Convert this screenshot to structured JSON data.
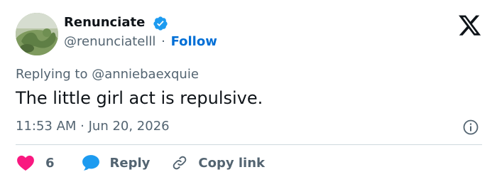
{
  "author": {
    "display_name": "Renunciate",
    "handle": "@renunciatelll",
    "separator": "·",
    "follow_label": "Follow"
  },
  "reply_context": {
    "text": "Replying to @anniebaexquie"
  },
  "tweet": {
    "text": "The little girl act is repulsive.",
    "timestamp": "11:53 AM · Jun 20, 2026"
  },
  "actions": {
    "like_count": "6",
    "reply_label": "Reply",
    "copy_link_label": "Copy link"
  },
  "colors": {
    "text_primary": "#0f1419",
    "text_secondary": "#536471",
    "follow_blue": "#006fd6",
    "verified_blue": "#1d9bf0",
    "like_red": "#f91880",
    "divider": "#cfd9de"
  },
  "icons": {
    "verified": "verified-badge-icon",
    "platform": "x-logo-icon",
    "info": "info-icon",
    "like": "heart-icon",
    "reply": "speech-bubble-icon",
    "copy": "link-icon"
  }
}
